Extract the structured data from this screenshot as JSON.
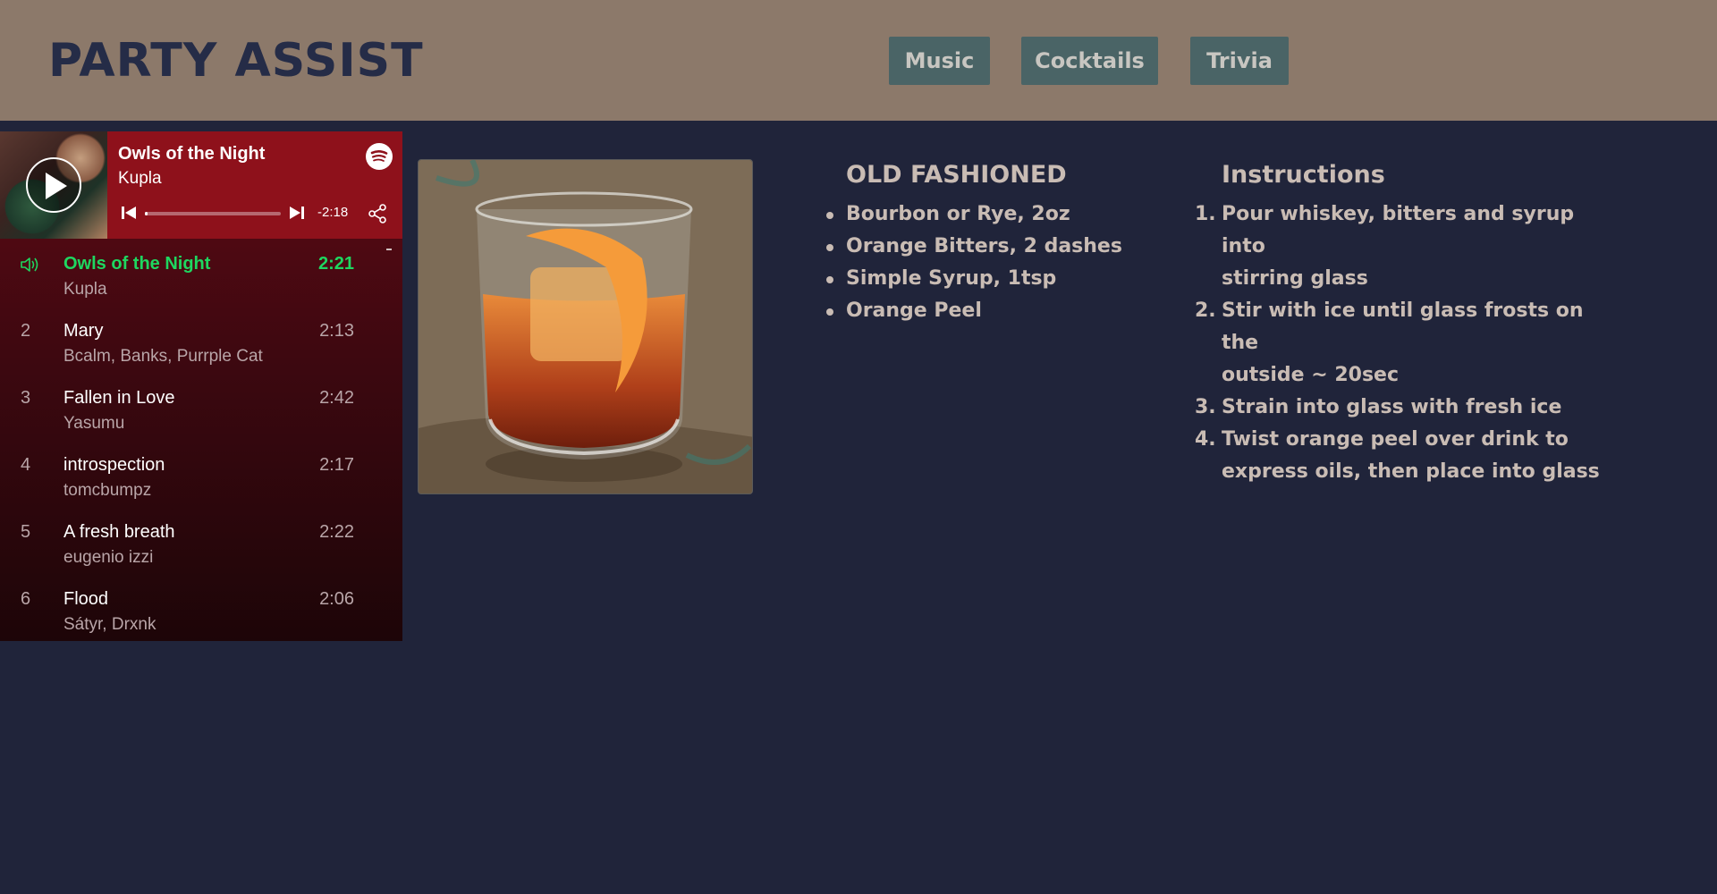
{
  "header": {
    "logo": "PARTY ASSIST",
    "nav": [
      {
        "label": "Music"
      },
      {
        "label": "Cocktails"
      },
      {
        "label": "Trivia"
      }
    ]
  },
  "player": {
    "now_playing": {
      "title": "Owls of the Night",
      "artist": "Kupla",
      "time_remaining": "-2:18",
      "progress_fraction": 0.01
    },
    "tracks": [
      {
        "num": "1",
        "title": "Owls of the Night",
        "artist": "Kupla",
        "duration": "2:21",
        "active": true
      },
      {
        "num": "2",
        "title": "Mary",
        "artist": "Bcalm, Banks, Purrple Cat",
        "duration": "2:13"
      },
      {
        "num": "3",
        "title": "Fallen in Love",
        "artist": "Yasumu",
        "duration": "2:42"
      },
      {
        "num": "4",
        "title": "introspection",
        "artist": "tomcbumpz",
        "duration": "2:17"
      },
      {
        "num": "5",
        "title": "A fresh breath",
        "artist": "eugenio izzi",
        "duration": "2:22"
      },
      {
        "num": "6",
        "title": "Flood",
        "artist": "Sátyr, Drxnk",
        "duration": "2:06"
      }
    ],
    "colors": {
      "active": "#1ed760",
      "header_bg": "#8e111b"
    }
  },
  "cocktail": {
    "name": "OLD FASHIONED",
    "ingredients": [
      "Bourbon or Rye, 2oz",
      "Orange Bitters, 2 dashes",
      "Simple Syrup, 1tsp",
      "Orange Peel"
    ],
    "instructions_title": "Instructions",
    "instructions": [
      {
        "num": "1.",
        "lines": [
          "Pour whiskey, bitters and syrup into",
          "stirring glass"
        ]
      },
      {
        "num": "2.",
        "lines": [
          "Stir with ice until glass frosts on the",
          "outside ~ 20sec"
        ]
      },
      {
        "num": "3.",
        "lines": [
          "Strain into glass with fresh ice"
        ]
      },
      {
        "num": "4.",
        "lines": [
          "Twist orange peel over drink to",
          "express oils, then place into glass"
        ]
      }
    ]
  }
}
